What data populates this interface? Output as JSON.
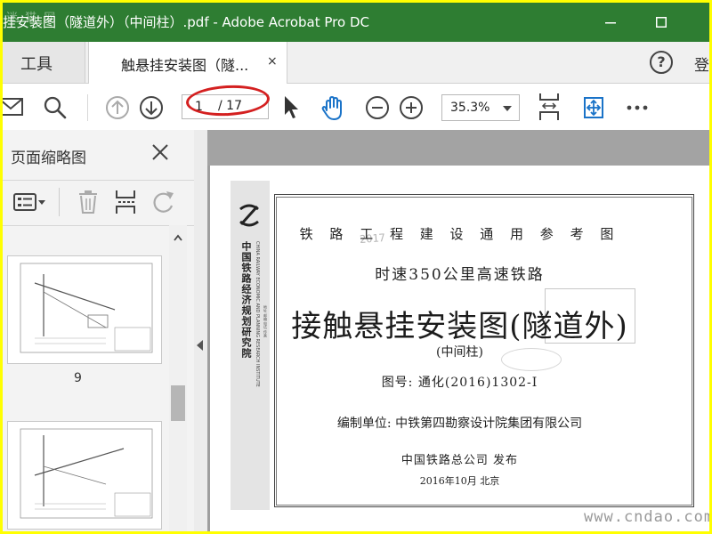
{
  "window": {
    "title": "挂安装图（隧道外）（中间柱）.pdf - Adobe Acrobat Pro DC",
    "watermark_top": "迷 猫 网",
    "minimize_icon": "minimize-icon",
    "maximize_icon": "maximize-icon"
  },
  "tabs": {
    "tools_label": "工具",
    "doc_label": "触悬挂安装图（隧...",
    "close_symbol": "×",
    "help_symbol": "?",
    "login_label": "登"
  },
  "toolbar": {
    "page_current": "1",
    "page_total": "/ 17",
    "zoom_value": "35.3%",
    "icons": [
      "mail-icon",
      "search-icon",
      "prev-page-icon",
      "next-page-icon",
      "select-cursor-icon",
      "hand-tool-icon",
      "zoom-out-icon",
      "zoom-in-icon",
      "fit-width-icon",
      "scroll-mode-icon",
      "more-icon"
    ]
  },
  "left_panel": {
    "title": "页面缩略图",
    "thumbnails": [
      {
        "label": "9"
      },
      {
        "label": ""
      }
    ]
  },
  "document": {
    "faint_stamp": "2017",
    "line1": "铁 路 工 程 建 设 通 用 参 考 图",
    "line2": "时速350公里高速铁路",
    "line3": "接触悬挂安装图(隧道外)",
    "line4": "(中间柱)",
    "line5": "图号: 通化(2016)1302-I",
    "line6": "编制单位: 中铁第四勘察设计院集团有限公司",
    "line7": "中国铁路总公司 发布",
    "line8": "2016年10月  北京",
    "org_name": "中国铁路经济规划研究院",
    "org_name_en": "CHINA RAILWAY ECONOMIC AND PLANNING RESEARCH INSTITUTE",
    "org_contact": "地址  邮编  电话  传真",
    "site_watermark": "www.cndao.com"
  }
}
